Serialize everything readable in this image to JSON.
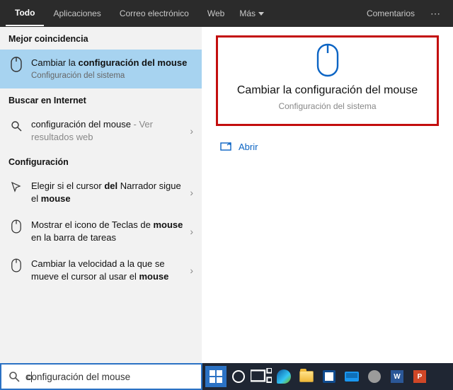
{
  "tabs": {
    "all": "Todo",
    "apps": "Aplicaciones",
    "mail": "Correo electrónico",
    "web": "Web",
    "more": "Más",
    "comments": "Comentarios"
  },
  "left": {
    "best_match_head": "Mejor coincidencia",
    "best_match": {
      "title_pre": "Cambiar la ",
      "title_bold": "configuración del mouse",
      "sub": "Configuración del sistema"
    },
    "web_head": "Buscar en Internet",
    "web_item": {
      "label": "configuración del mouse",
      "suffix": " - Ver resultados web"
    },
    "config_head": "Configuración",
    "c1": {
      "pre": "Elegir si el cursor ",
      "b1": "del",
      "mid": " Narrador sigue el ",
      "b2": "mouse"
    },
    "c2": {
      "pre": "Mostrar el icono de Teclas de ",
      "b1": "mouse",
      "suf": " en la barra de tareas"
    },
    "c3": {
      "pre": "Cambiar la velocidad a la que se mueve el cursor al usar el ",
      "b1": "mouse"
    }
  },
  "right": {
    "title": "Cambiar la configuración del mouse",
    "sub": "Configuración del sistema",
    "open": "Abrir"
  },
  "search": {
    "text": "configuración del mouse",
    "prefix_bold": "c"
  },
  "taskbar_letters": {
    "word": "W",
    "ppt": "P"
  }
}
